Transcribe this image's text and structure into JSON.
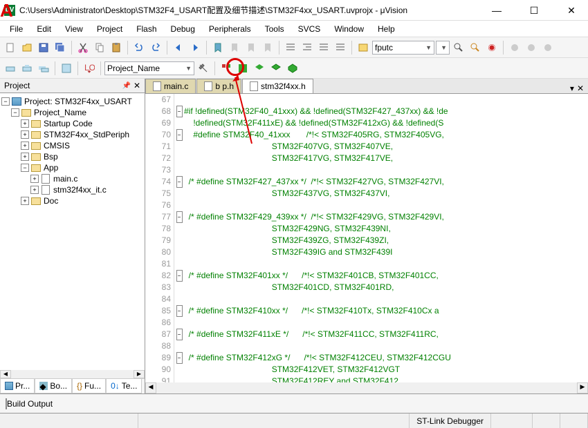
{
  "titlebar": {
    "icon_label": "μV",
    "title": "C:\\Users\\Administrator\\Desktop\\STM32F4_USART配置及细节描述\\STM32F4xx_USART.uvprojx - μVision"
  },
  "menubar": [
    "File",
    "Edit",
    "View",
    "Project",
    "Flash",
    "Debug",
    "Peripherals",
    "Tools",
    "SVCS",
    "Window",
    "Help"
  ],
  "toolbar2": {
    "target_combo": "Project_Name"
  },
  "toolbar1": {
    "find_combo": "fputc"
  },
  "project_panel": {
    "title": "Project",
    "tree": {
      "root": "Project: STM32F4xx_USART",
      "target": "Project_Name",
      "groups": [
        "Startup Code",
        "STM32F4xx_StdPeriph",
        "CMSIS",
        "Bsp",
        "App",
        "Doc"
      ],
      "app_files": [
        "main.c",
        "stm32f4xx_it.c"
      ]
    },
    "tabs": [
      "Pr...",
      "Bo...",
      "Fu...",
      "Te..."
    ]
  },
  "editor": {
    "tabs": [
      {
        "label": "main.c",
        "active": false
      },
      {
        "label": "b p.h",
        "active": false
      },
      {
        "label": "stm32f4xx.h",
        "active": true
      }
    ],
    "line_start": 67,
    "lines": [
      "",
      "#if !defined(STM32F40_41xxx) && !defined(STM32F427_437xx) && !de",
      "    !defined(STM32F411xE) && !defined(STM32F412xG) && !defined(S",
      "    #define STM32F40_41xxx       /*!< STM32F405RG, STM32F405VG,",
      "                                      STM32F407VG, STM32F407VE,",
      "                                      STM32F417VG, STM32F417VE,",
      "",
      "  /* #define STM32F427_437xx */  /*!< STM32F427VG, STM32F427VI,",
      "                                      STM32F437VG, STM32F437VI,",
      "",
      "  /* #define STM32F429_439xx */  /*!< STM32F429VG, STM32F429VI,",
      "                                      STM32F429NG, STM32F439NI,",
      "                                      STM32F439ZG, STM32F439ZI,",
      "                                      STM32F439IG and STM32F439I",
      "",
      "  /* #define STM32F401xx */      /*!< STM32F401CB, STM32F401CC,",
      "                                      STM32F401CD, STM32F401RD,",
      "",
      "  /* #define STM32F410xx */      /*!< STM32F410Tx, STM32F410Cx a",
      "",
      "  /* #define STM32F411xE */      /*!< STM32F411CC, STM32F411RC,",
      "",
      "  /* #define STM32F412xG */      /*!< STM32F412CEU, STM32F412CGU",
      "                                      STM32F412VET, STM32F412VGT",
      "                                      STM32F412REY and STM32F412"
    ],
    "fold_lines": [
      68,
      70,
      74,
      77,
      82,
      85,
      87,
      89
    ]
  },
  "buildout": {
    "label": "Build Output"
  },
  "statusbar": {
    "debugger": "ST-Link Debugger"
  },
  "annotation": {
    "letter": "A"
  }
}
